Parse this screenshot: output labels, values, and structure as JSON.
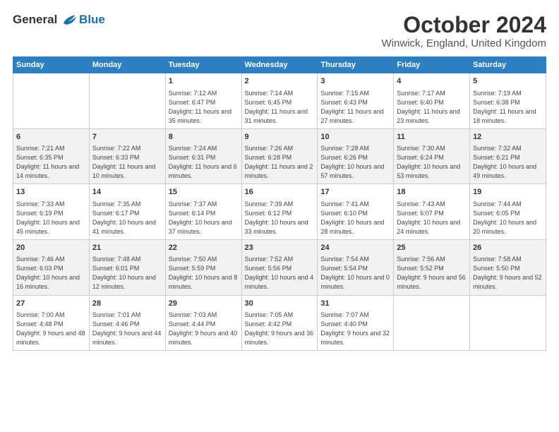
{
  "header": {
    "logo_line1": "General",
    "logo_line2": "Blue",
    "title": "October 2024",
    "subtitle": "Winwick, England, United Kingdom"
  },
  "columns": [
    "Sunday",
    "Monday",
    "Tuesday",
    "Wednesday",
    "Thursday",
    "Friday",
    "Saturday"
  ],
  "weeks": [
    [
      {
        "day": "",
        "info": ""
      },
      {
        "day": "",
        "info": ""
      },
      {
        "day": "1",
        "info": "Sunrise: 7:12 AM\nSunset: 6:47 PM\nDaylight: 11 hours and 35 minutes."
      },
      {
        "day": "2",
        "info": "Sunrise: 7:14 AM\nSunset: 6:45 PM\nDaylight: 11 hours and 31 minutes."
      },
      {
        "day": "3",
        "info": "Sunrise: 7:15 AM\nSunset: 6:43 PM\nDaylight: 11 hours and 27 minutes."
      },
      {
        "day": "4",
        "info": "Sunrise: 7:17 AM\nSunset: 6:40 PM\nDaylight: 11 hours and 23 minutes."
      },
      {
        "day": "5",
        "info": "Sunrise: 7:19 AM\nSunset: 6:38 PM\nDaylight: 11 hours and 18 minutes."
      }
    ],
    [
      {
        "day": "6",
        "info": "Sunrise: 7:21 AM\nSunset: 6:35 PM\nDaylight: 11 hours and 14 minutes."
      },
      {
        "day": "7",
        "info": "Sunrise: 7:22 AM\nSunset: 6:33 PM\nDaylight: 11 hours and 10 minutes."
      },
      {
        "day": "8",
        "info": "Sunrise: 7:24 AM\nSunset: 6:31 PM\nDaylight: 11 hours and 6 minutes."
      },
      {
        "day": "9",
        "info": "Sunrise: 7:26 AM\nSunset: 6:28 PM\nDaylight: 11 hours and 2 minutes."
      },
      {
        "day": "10",
        "info": "Sunrise: 7:28 AM\nSunset: 6:26 PM\nDaylight: 10 hours and 57 minutes."
      },
      {
        "day": "11",
        "info": "Sunrise: 7:30 AM\nSunset: 6:24 PM\nDaylight: 10 hours and 53 minutes."
      },
      {
        "day": "12",
        "info": "Sunrise: 7:32 AM\nSunset: 6:21 PM\nDaylight: 10 hours and 49 minutes."
      }
    ],
    [
      {
        "day": "13",
        "info": "Sunrise: 7:33 AM\nSunset: 6:19 PM\nDaylight: 10 hours and 45 minutes."
      },
      {
        "day": "14",
        "info": "Sunrise: 7:35 AM\nSunset: 6:17 PM\nDaylight: 10 hours and 41 minutes."
      },
      {
        "day": "15",
        "info": "Sunrise: 7:37 AM\nSunset: 6:14 PM\nDaylight: 10 hours and 37 minutes."
      },
      {
        "day": "16",
        "info": "Sunrise: 7:39 AM\nSunset: 6:12 PM\nDaylight: 10 hours and 33 minutes."
      },
      {
        "day": "17",
        "info": "Sunrise: 7:41 AM\nSunset: 6:10 PM\nDaylight: 10 hours and 28 minutes."
      },
      {
        "day": "18",
        "info": "Sunrise: 7:43 AM\nSunset: 6:07 PM\nDaylight: 10 hours and 24 minutes."
      },
      {
        "day": "19",
        "info": "Sunrise: 7:44 AM\nSunset: 6:05 PM\nDaylight: 10 hours and 20 minutes."
      }
    ],
    [
      {
        "day": "20",
        "info": "Sunrise: 7:46 AM\nSunset: 6:03 PM\nDaylight: 10 hours and 16 minutes."
      },
      {
        "day": "21",
        "info": "Sunrise: 7:48 AM\nSunset: 6:01 PM\nDaylight: 10 hours and 12 minutes."
      },
      {
        "day": "22",
        "info": "Sunrise: 7:50 AM\nSunset: 5:59 PM\nDaylight: 10 hours and 8 minutes."
      },
      {
        "day": "23",
        "info": "Sunrise: 7:52 AM\nSunset: 5:56 PM\nDaylight: 10 hours and 4 minutes."
      },
      {
        "day": "24",
        "info": "Sunrise: 7:54 AM\nSunset: 5:54 PM\nDaylight: 10 hours and 0 minutes."
      },
      {
        "day": "25",
        "info": "Sunrise: 7:56 AM\nSunset: 5:52 PM\nDaylight: 9 hours and 56 minutes."
      },
      {
        "day": "26",
        "info": "Sunrise: 7:58 AM\nSunset: 5:50 PM\nDaylight: 9 hours and 52 minutes."
      }
    ],
    [
      {
        "day": "27",
        "info": "Sunrise: 7:00 AM\nSunset: 4:48 PM\nDaylight: 9 hours and 48 minutes."
      },
      {
        "day": "28",
        "info": "Sunrise: 7:01 AM\nSunset: 4:46 PM\nDaylight: 9 hours and 44 minutes."
      },
      {
        "day": "29",
        "info": "Sunrise: 7:03 AM\nSunset: 4:44 PM\nDaylight: 9 hours and 40 minutes."
      },
      {
        "day": "30",
        "info": "Sunrise: 7:05 AM\nSunset: 4:42 PM\nDaylight: 9 hours and 36 minutes."
      },
      {
        "day": "31",
        "info": "Sunrise: 7:07 AM\nSunset: 4:40 PM\nDaylight: 9 hours and 32 minutes."
      },
      {
        "day": "",
        "info": ""
      },
      {
        "day": "",
        "info": ""
      }
    ]
  ]
}
